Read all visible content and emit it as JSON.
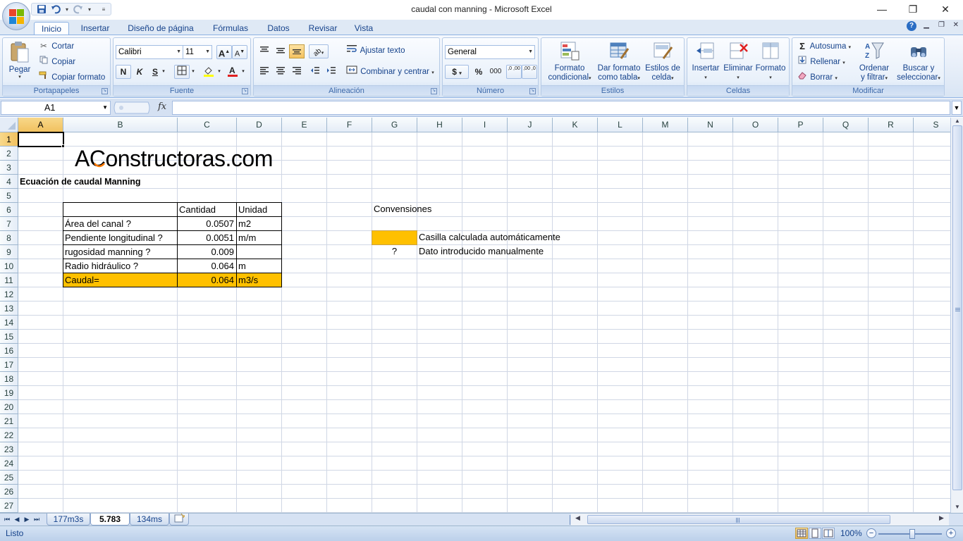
{
  "window": {
    "title": "caudal con manning - Microsoft Excel",
    "minimize": "—",
    "restore": "❐",
    "close": "✕"
  },
  "qat": {
    "save_icon": "save-icon",
    "undo_icon": "undo-icon",
    "redo_icon": "redo-icon"
  },
  "tabs": [
    {
      "label": "Inicio",
      "active": true
    },
    {
      "label": "Insertar"
    },
    {
      "label": "Diseño de página"
    },
    {
      "label": "Fórmulas"
    },
    {
      "label": "Datos"
    },
    {
      "label": "Revisar"
    },
    {
      "label": "Vista"
    }
  ],
  "ribbon": {
    "portapapeles": {
      "label": "Portapapeles",
      "pegar": "Pegar",
      "cortar": "Cortar",
      "copiar": "Copiar",
      "copiar_formato": "Copiar formato"
    },
    "fuente": {
      "label": "Fuente",
      "font": "Calibri",
      "size": "11",
      "bold": "N",
      "italic": "K",
      "underline": "S"
    },
    "alineacion": {
      "label": "Alineación",
      "ajustar": "Ajustar texto",
      "combinar": "Combinar y centrar"
    },
    "numero": {
      "label": "Número",
      "format": "General",
      "currency": "$",
      "percent": "%",
      "thousands": "000",
      "inc_dec": ",0 ,00",
      "dec_dec": ",00 ,0"
    },
    "estilos": {
      "label": "Estilos",
      "formato_cond_1": "Formato",
      "formato_cond_2": "condicional",
      "dar_formato_1": "Dar formato",
      "dar_formato_2": "como tabla",
      "estilos_celda_1": "Estilos de",
      "estilos_celda_2": "celda"
    },
    "celdas": {
      "label": "Celdas",
      "insertar": "Insertar",
      "eliminar": "Eliminar",
      "formato": "Formato"
    },
    "modificar": {
      "label": "Modificar",
      "autosuma": "Autosuma",
      "rellenar": "Rellenar",
      "borrar": "Borrar",
      "ordenar_1": "Ordenar",
      "ordenar_2": "y filtrar",
      "buscar_1": "Buscar y",
      "buscar_2": "seleccionar"
    }
  },
  "formula_bar": {
    "name_box": "A1",
    "fx": "fx",
    "formula": ""
  },
  "columns": [
    "A",
    "B",
    "C",
    "D",
    "E",
    "F",
    "G",
    "H",
    "I",
    "J",
    "K",
    "L",
    "M",
    "N",
    "O",
    "P",
    "Q",
    "R",
    "S"
  ],
  "rows": [
    "1",
    "2",
    "3",
    "4",
    "5",
    "6",
    "7",
    "8",
    "9",
    "10",
    "11",
    "12",
    "13",
    "14",
    "15",
    "16",
    "17",
    "18",
    "19",
    "20",
    "21",
    "22",
    "23",
    "24",
    "25",
    "26",
    "27"
  ],
  "sheet": {
    "logo_text": "AConstructoras.com",
    "title": "Ecuación de caudal Manning",
    "table_header": {
      "cantidad": "Cantidad",
      "unidad": "Unidad"
    },
    "table_rows": [
      {
        "label": "Área del canal ?",
        "value": "0.0507",
        "unit": "m2"
      },
      {
        "label": "Pendiente longitudinal ?",
        "value": "0.0051",
        "unit": "m/m"
      },
      {
        "label": "rugosidad manning ?",
        "value": "0.009",
        "unit": ""
      },
      {
        "label": "Radio hidráulico ?",
        "value": "0.064",
        "unit": "m"
      }
    ],
    "result": {
      "label": "Caudal=",
      "value": "0.064",
      "unit": "m3/s"
    },
    "conventions": {
      "title": "Convensiones",
      "calc_label": "Casilla calculada automáticamente",
      "manual_symbol": "?",
      "manual_label": "Dato introducido manualmente"
    },
    "highlight_color": "#ffc000"
  },
  "sheet_tabs": [
    {
      "label": "177m3s"
    },
    {
      "label": "5.783",
      "active": true
    },
    {
      "label": "134ms"
    }
  ],
  "status": {
    "text": "Listo",
    "zoom": "100%"
  }
}
